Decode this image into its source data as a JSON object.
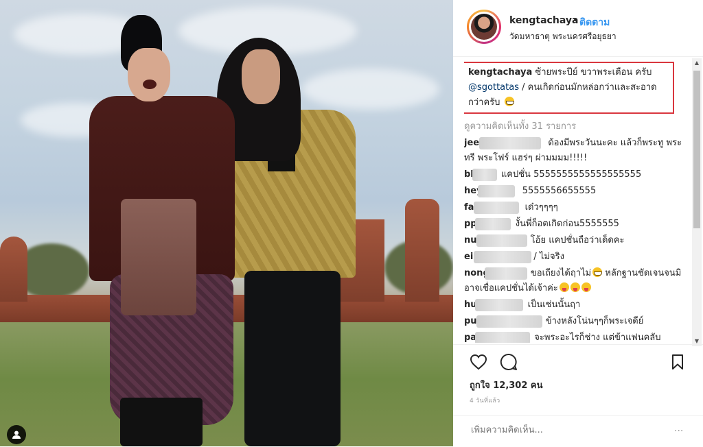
{
  "post": {
    "username": "kengtachaya",
    "separator": "•",
    "follow_label": "ติดตาม",
    "location": "วัดมหาธาตุ พระนครศรีอยุธยา"
  },
  "caption": {
    "username": "kengtachaya",
    "text1": "ซ้ายพระปีย์ ขวาพระเตือน ครับ",
    "mention": "@sgottatas",
    "text2": "/ คนเกิดก่อนมักหล่อกว่าและสะอาดกว่าครับ"
  },
  "view_all_comments": "ดูความคิดเห็นทั้ง 31 รายการ",
  "comments": [
    {
      "name": "jee",
      "text": "ต้องมีพระวันนะคะ แล้วก็พระทู พระทรี พระโฟร์ แฮร่ๆ ผ่ามมมม!!!!!"
    },
    {
      "name": "bl",
      "text": "แคปชั่น 5555555555555555555"
    },
    {
      "name": "hey",
      "text": "5555556655555"
    },
    {
      "name": "fa",
      "text": "เด๋วๆๆๆๆ"
    },
    {
      "name": "pp",
      "text": "งั้นพี่ก็อตเกิดก่อน5555555"
    },
    {
      "name": "nu",
      "text": "โอ้ย แคปชั่นถือว่าเด็ดคะ"
    },
    {
      "name": "ei",
      "text": "/ ไม่จริง"
    },
    {
      "name": "nong",
      "text": "ขอเถียงได้ฤาไม่",
      "text_b": "หลักฐานชัดเจนจนมิอาจเชื่อแคปชั่นได้เจ้าค่ะ"
    },
    {
      "name": "hu",
      "text": "เป็นเช่นนั้นฤา"
    },
    {
      "name": "pu",
      "text": "ข้างหลังโน่นๆๆก็พระเจดีย์"
    },
    {
      "name": "pa",
      "text": "จะพระอะไรก็ช่าง แต่ข้าแฟนคลับ"
    }
  ],
  "likes": "ถูกใจ 12,302 คน",
  "time_ago": "4 วันที่แล้ว",
  "add_comment_placeholder": "เพิ่มความคิดเห็น...",
  "more_options": "...",
  "colors": {
    "accent": "#3897f0",
    "highlight_border": "#d9363e",
    "mention": "#003569"
  },
  "icons": [
    "heart-icon",
    "comment-icon",
    "bookmark-icon",
    "user-tag-icon"
  ]
}
